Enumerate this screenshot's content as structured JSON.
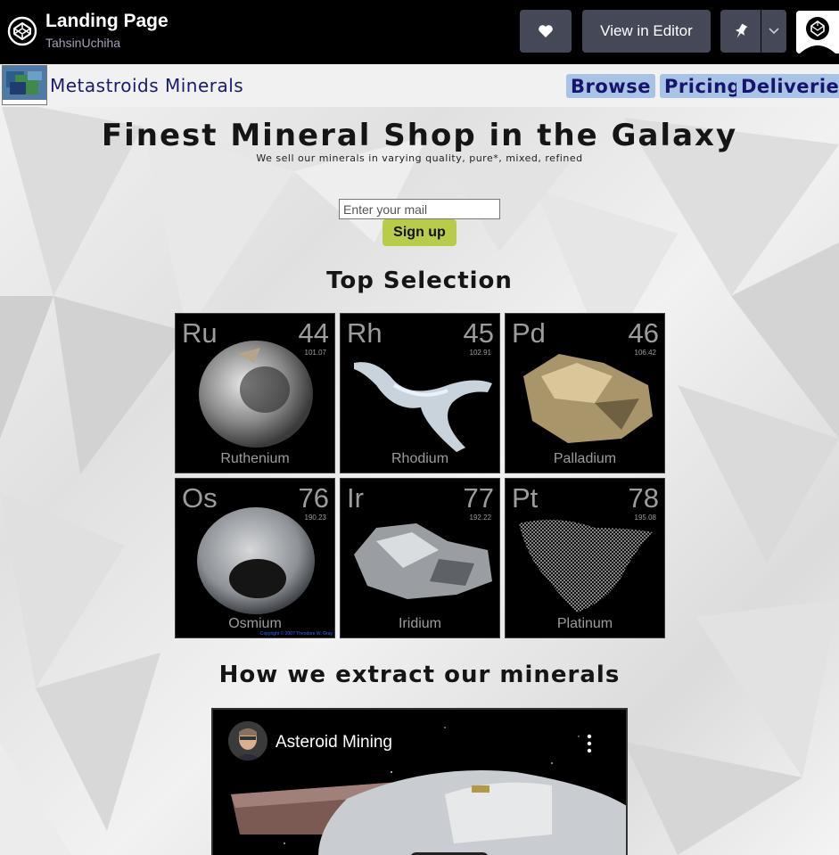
{
  "codepen": {
    "pen_title": "Landing Page",
    "author": "TahsinUchiha",
    "view_in_editor_label": "View in Editor",
    "icons": [
      "codepen-logo-icon",
      "heart-icon",
      "pin-icon",
      "chevron-down-icon",
      "avatar"
    ]
  },
  "site": {
    "brand_name": "Metastroids Minerals",
    "nav": [
      {
        "label": "Browse"
      },
      {
        "label": "Pricing"
      },
      {
        "label": "Deliveries"
      }
    ],
    "hero": {
      "title": "Finest Mineral Shop in the Galaxy",
      "subtitle": "We sell our minerals in varying quality, pure*, mixed, refined"
    },
    "signup": {
      "placeholder": "Enter your mail",
      "button_label": "Sign up"
    },
    "top_selection_title": "Top Selection",
    "elements": [
      {
        "symbol": "Ru",
        "number": "44",
        "mass": "101.07",
        "name": "Ruthenium"
      },
      {
        "symbol": "Rh",
        "number": "45",
        "mass": "102.91",
        "name": "Rhodium"
      },
      {
        "symbol": "Pd",
        "number": "46",
        "mass": "106.42",
        "name": "Palladium"
      },
      {
        "symbol": "Os",
        "number": "76",
        "mass": "190.23",
        "name": "Osmium",
        "copyright": "Copyright © 2007 Theodore W. Gray"
      },
      {
        "symbol": "Ir",
        "number": "77",
        "mass": "192.22",
        "name": "Iridium"
      },
      {
        "symbol": "Pt",
        "number": "78",
        "mass": "195.08",
        "name": "Platinum"
      }
    ],
    "extract_title": "How we extract our minerals",
    "video": {
      "title": "Asteroid Mining"
    }
  },
  "colors": {
    "codepen_bar": "#000000",
    "codepen_button": "#444857",
    "nav_link_bg": "#a9c3e6",
    "nav_link_text": "#15156b",
    "signup_button": "#b9cc4a",
    "tile_bg": "#000000",
    "tile_text": "#9c9c9c"
  }
}
